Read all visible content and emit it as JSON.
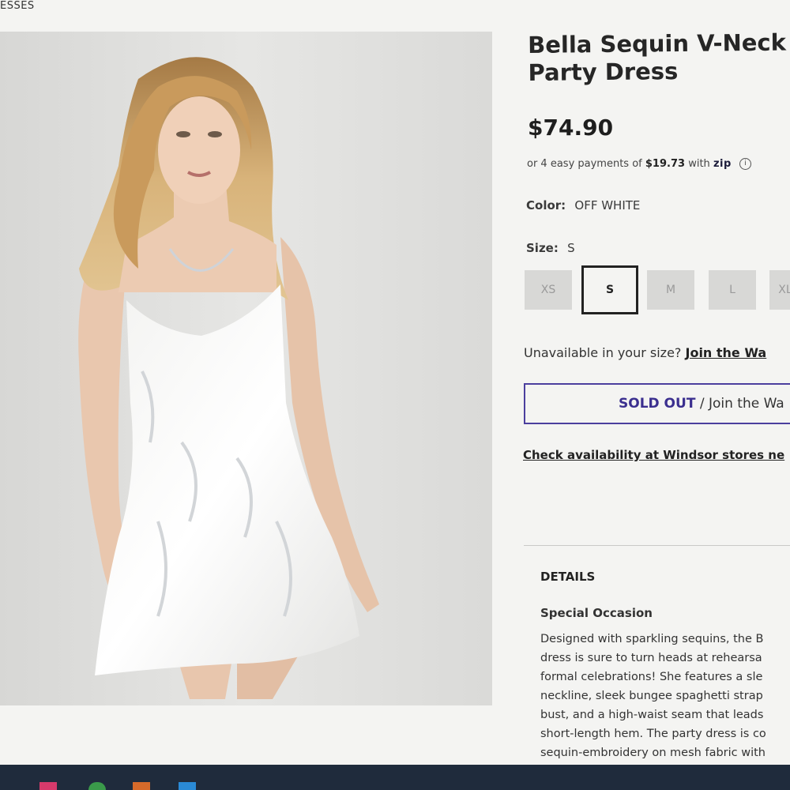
{
  "breadcrumb": "ESSES",
  "product": {
    "title_line1": "Bella Sequin V-Neck",
    "title_line2": "Party Dress",
    "price": "$74.90"
  },
  "payments": {
    "prefix": "or 4 easy payments of",
    "amount": "$19.73",
    "with": "with",
    "provider": "zip",
    "info_icon": "info-icon"
  },
  "color": {
    "label": "Color:",
    "value": "OFF WHITE"
  },
  "size": {
    "label": "Size:",
    "value": "S",
    "options": [
      "XS",
      "S",
      "M",
      "L",
      "XL"
    ],
    "selected": "S"
  },
  "waitlist": {
    "question": "Unavailable in your size?",
    "link": "Join the Wa"
  },
  "sold_out_button": {
    "primary": "SOLD OUT",
    "separator": "/",
    "secondary": "Join the Wa"
  },
  "check_availability": "Check availability at Windsor stores ne",
  "details": {
    "heading": "DETAILS",
    "subheading": "Special Occasion",
    "lines": [
      "Designed with sparkling sequins, the B",
      "dress is sure to turn heads at rehearsa",
      "formal celebrations! She features a sle",
      "neckline, sleek bungee spaghetti strap",
      "bust, and a high-waist seam that leads",
      "short-length hem. The party dress is co",
      "sequin-embroidery on mesh fabric with"
    ]
  },
  "colors": {
    "accent": "#4b3f9e",
    "sold_out_text": "#3b2f8f",
    "page_bg": "#f4f4f2",
    "taskbar": "#1f2b3c"
  }
}
